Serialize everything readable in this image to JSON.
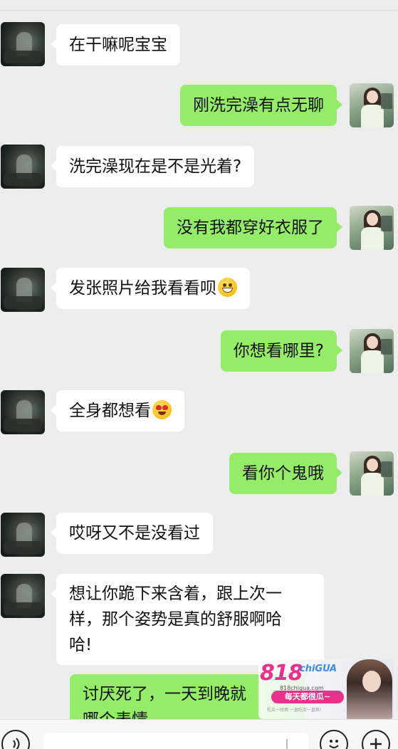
{
  "messages": [
    {
      "side": "left",
      "text": "在干嘛呢宝宝"
    },
    {
      "side": "right",
      "text": "刚洗完澡有点无聊"
    },
    {
      "side": "left",
      "text": "洗完澡现在是不是光着?"
    },
    {
      "side": "right",
      "text": "没有我都穿好衣服了"
    },
    {
      "side": "left",
      "text": "发张照片给我看看呗",
      "emoji": "grinning-face-emoji"
    },
    {
      "side": "right",
      "text": "你想看哪里?"
    },
    {
      "side": "left",
      "text": "全身都想看",
      "emoji": "heart-eyes-emoji"
    },
    {
      "side": "right",
      "text": "看你个鬼哦"
    },
    {
      "side": "left",
      "text": "哎呀又不是没看过"
    },
    {
      "side": "left",
      "lines": [
        "想让你跪下来含着，跟上次一",
        "样，那个姿势是真的舒服啊哈",
        "哈!"
      ]
    },
    {
      "side": "right",
      "lines": [
        "讨厌死了，一天到晚就",
        "哪个表情"
      ]
    }
  ],
  "watermark": {
    "brand": "818",
    "brand_suffix": "chiGUA",
    "url": "818chigua.com",
    "slogan": "每天都很瓜~",
    "footer": "吃瓜一时爽 一直吃瓜一直爽!"
  },
  "toolbar": {
    "voice_icon": "voice-wave-icon",
    "emoji_icon": "smiley-icon",
    "plus_icon": "plus-icon"
  },
  "colors": {
    "background": "#ededed",
    "left_bubble": "#ffffff",
    "right_bubble": "#95ec69"
  }
}
